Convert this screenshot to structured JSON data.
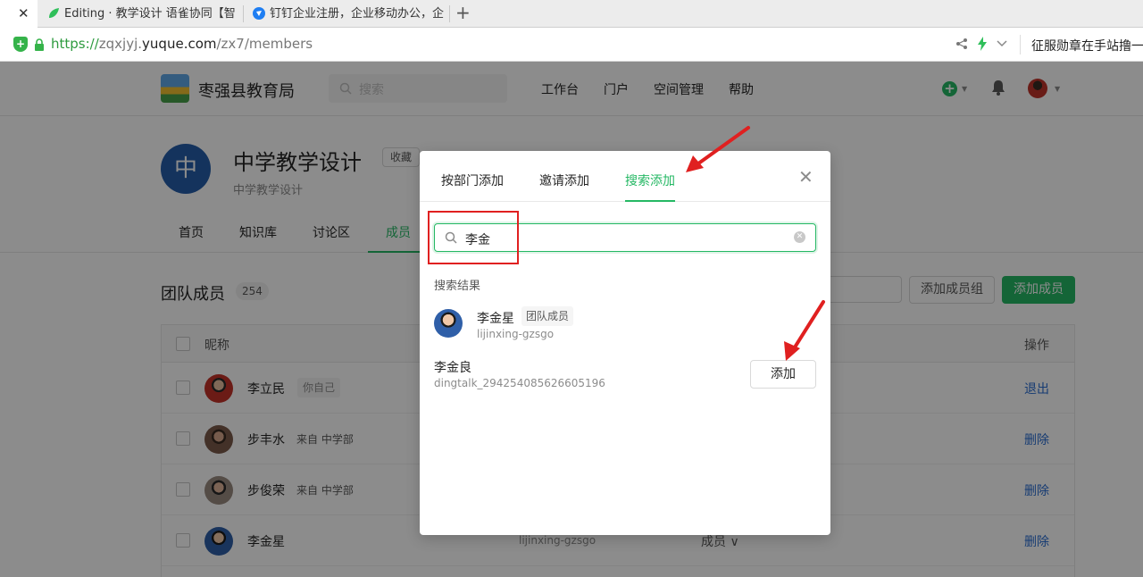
{
  "browser": {
    "tabs": [
      {
        "label": ""
      },
      {
        "label": "Editing · 教学设计 语雀协同【智"
      },
      {
        "label": "钉钉企业注册，企业移动办公，企"
      }
    ],
    "url": {
      "scheme": "https://",
      "pre": "zqxjyj.",
      "host": "yuque.com",
      "path": "/zx7/members"
    },
    "extension_text": "征服勋章在手站撸一"
  },
  "header": {
    "org_name": "枣强县教育局",
    "search_placeholder": "搜索",
    "nav": [
      "工作台",
      "门户",
      "空间管理",
      "帮助"
    ]
  },
  "book": {
    "avatar_char": "中",
    "title": "中学教学设计",
    "description": "中学教学设计",
    "collect_label": "收藏"
  },
  "subnav": {
    "tabs": [
      "首页",
      "知识库",
      "讨论区",
      "成员"
    ],
    "active": "成员"
  },
  "members": {
    "title": "团队成员",
    "count": "254",
    "add_group_label": "添加成员组",
    "add_member_label": "添加成员",
    "columns": {
      "name": "昵称",
      "action": "操作"
    },
    "rows": [
      {
        "name": "李立民",
        "tag": "你自己",
        "from": "",
        "login": "",
        "role": "",
        "action": "退出"
      },
      {
        "name": "步丰水",
        "tag": "",
        "from": "来自 中学部",
        "login": "",
        "role": "",
        "action": "删除"
      },
      {
        "name": "步俊荣",
        "tag": "",
        "from": "来自 中学部",
        "login": "",
        "role": "",
        "action": "删除"
      },
      {
        "name": "李金星",
        "tag": "",
        "from": "",
        "login": "lijinxing-gzsgo",
        "role": "成员 ∨",
        "action": "删除"
      }
    ]
  },
  "modal": {
    "tabs": [
      "按部门添加",
      "邀请添加",
      "搜索添加"
    ],
    "active_tab": "搜索添加",
    "search_value": "李金",
    "results_label": "搜索结果",
    "results": [
      {
        "name": "李金星",
        "tag": "团队成员",
        "login": "lijinxing-gzsgo"
      },
      {
        "name": "李金良",
        "login": "dingtalk_294254085626605196",
        "button": "添加"
      }
    ]
  },
  "colors": {
    "accent": "#25b864",
    "annotation_red": "#e02020",
    "link": "#2a6dd1"
  }
}
